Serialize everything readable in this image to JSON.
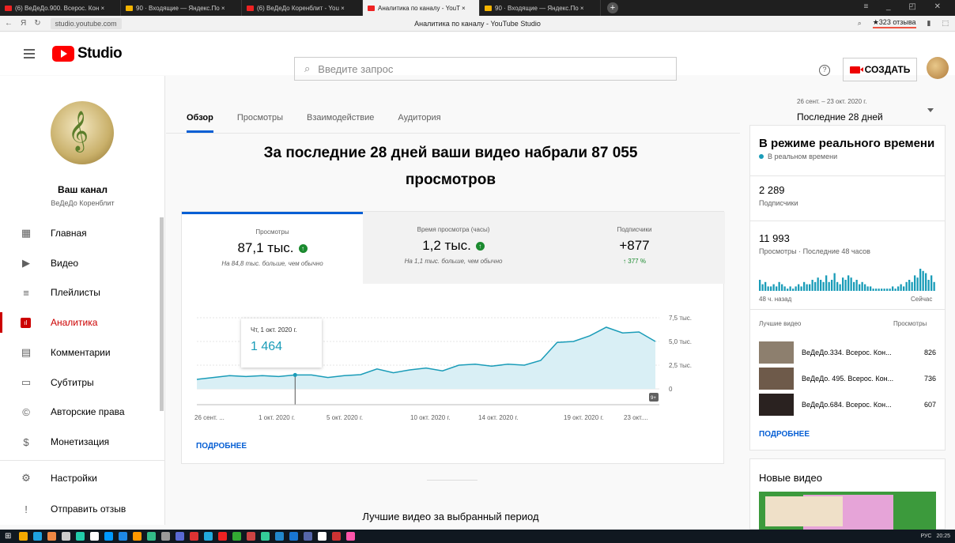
{
  "browser": {
    "tabs": [
      {
        "label": "(6) ВеДеДо.900. Всерос. Кон ×",
        "color": "#e22"
      },
      {
        "label": "90 · Входящие — Яндекс.По ×",
        "color": "#f5b400"
      },
      {
        "label": "(6) ВеДеДо Коренблит - You ×",
        "color": "#e22"
      },
      {
        "label": "Аналитика по каналу - YouT ×",
        "color": "#e22"
      },
      {
        "label": "90 · Входящие — Яндекс.По ×",
        "color": "#f5b400"
      }
    ],
    "active_tab": 3,
    "url": "studio.youtube.com",
    "page_title": "Аналитика по каналу - YouTube Studio",
    "reviews": "★323 отзыва",
    "nav_back": "←",
    "nav_y": "Я",
    "nav_reload": "↻"
  },
  "header": {
    "logo_text": "Studio",
    "search_placeholder": "Введите запрос",
    "create_label": "СОЗДАТЬ",
    "help": "?"
  },
  "channel": {
    "name": "Ваш канал",
    "handle": "ВеДеДо Коренблит"
  },
  "sidebar": {
    "items": [
      {
        "label": "Главная",
        "icon": "dashboard-icon",
        "glyph": "▦"
      },
      {
        "label": "Видео",
        "icon": "video-icon",
        "glyph": "▶"
      },
      {
        "label": "Плейлисты",
        "icon": "playlist-icon",
        "glyph": "≡"
      },
      {
        "label": "Аналитика",
        "icon": "analytics-icon",
        "glyph": "ıl"
      },
      {
        "label": "Комментарии",
        "icon": "comments-icon",
        "glyph": "▤"
      },
      {
        "label": "Субтитры",
        "icon": "subtitles-icon",
        "glyph": "▭"
      },
      {
        "label": "Авторские права",
        "icon": "copyright-icon",
        "glyph": "©"
      },
      {
        "label": "Монетизация",
        "icon": "dollar-icon",
        "glyph": "$"
      },
      {
        "label": "Настройки",
        "icon": "gear-icon",
        "glyph": "⚙"
      },
      {
        "label": "Отправить отзыв",
        "icon": "feedback-icon",
        "glyph": "!"
      }
    ],
    "active_index": 3
  },
  "tabs": [
    "Обзор",
    "Просмотры",
    "Взаимодействие",
    "Аудитория"
  ],
  "active_tab": 0,
  "headline_line1": "За последние 28 дней ваши видео набрали 87 055",
  "headline_line2": "просмотров",
  "metrics": [
    {
      "title": "Просмотры",
      "value": "87,1 тыс.",
      "note": "На 84,8 тыс. больше, чем обычно"
    },
    {
      "title": "Время просмотра (часы)",
      "value": "1,2 тыс.",
      "note": "На 1,1 тыс. больше, чем обычно"
    },
    {
      "title": "Подписчики",
      "value": "+877",
      "note": "↑ 377 %"
    }
  ],
  "tooltip": {
    "date": "Чт, 1 окт. 2020 г.",
    "value": "1 464"
  },
  "chart_data": {
    "type": "area",
    "series": [
      {
        "values": [
          1000,
          1200,
          1400,
          1300,
          1400,
          1300,
          1464,
          1470,
          1200,
          1400,
          1500,
          2100,
          1700,
          2000,
          2200,
          1900,
          2500,
          2600,
          2400,
          2600,
          2500,
          3000,
          4900,
          5000,
          5600,
          6500,
          5900,
          6000,
          5000
        ]
      }
    ],
    "ylim": [
      0,
      7500
    ],
    "yticks": [
      "7,5 тыс.",
      "5,0 тыс.",
      "2,5 тыс.",
      "0"
    ],
    "xticks": [
      "26 сент. ...",
      "1 окт. 2020 г.",
      "5 окт. 2020 г.",
      "10 окт. 2020 г.",
      "14 окт. 2020 г.",
      "19 окт. 2020 г.",
      "23 окт...."
    ],
    "highlight_index": 6,
    "badge": "9+",
    "line_color": "#1a9cb8",
    "fill_color": "#d9eff5"
  },
  "more_label": "ПОДРОБНЕЕ",
  "best_videos_label": "Лучшие видео за выбранный период",
  "period": {
    "range": "26 сент. – 23 окт. 2020 г.",
    "label": "Последние 28 дней"
  },
  "realtime": {
    "title": "В режиме реального времени",
    "live": "В реальном времени",
    "subs_value": "2 289",
    "subs_label": "Подписчики",
    "views_value": "11 993",
    "views_label": "Просмотры · Последние 48 часов",
    "axis_left": "48 ч. назад",
    "axis_right": "Сейчас",
    "top_label": "Лучшие видео",
    "top_views_label": "Просмотры",
    "bars": [
      5,
      3,
      4,
      2,
      2,
      3,
      2,
      4,
      3,
      2,
      1,
      2,
      1,
      2,
      3,
      2,
      4,
      3,
      3,
      5,
      4,
      6,
      5,
      4,
      7,
      4,
      5,
      8,
      4,
      3,
      6,
      5,
      7,
      6,
      4,
      5,
      3,
      4,
      3,
      2,
      2,
      1,
      1,
      1,
      1,
      1,
      1,
      1,
      2,
      1,
      2,
      3,
      2,
      4,
      5,
      4,
      7,
      6,
      10,
      9,
      8,
      5,
      7,
      4
    ],
    "videos": [
      {
        "title": "ВеДеДо.334. Всерос. Кон...",
        "views": "826",
        "thumb": "#8d7f6e"
      },
      {
        "title": "ВеДеДо. 495. Всерос. Кон...",
        "views": "736",
        "thumb": "#6e5a4a"
      },
      {
        "title": "ВеДеДо.684. Всерос. Кон...",
        "views": "607",
        "thumb": "#2a2220"
      }
    ],
    "more": "ПОДРОБНЕЕ"
  },
  "new_videos": {
    "title": "Новые видео"
  },
  "tray": {
    "lang": "РУС",
    "time": "20:25"
  }
}
